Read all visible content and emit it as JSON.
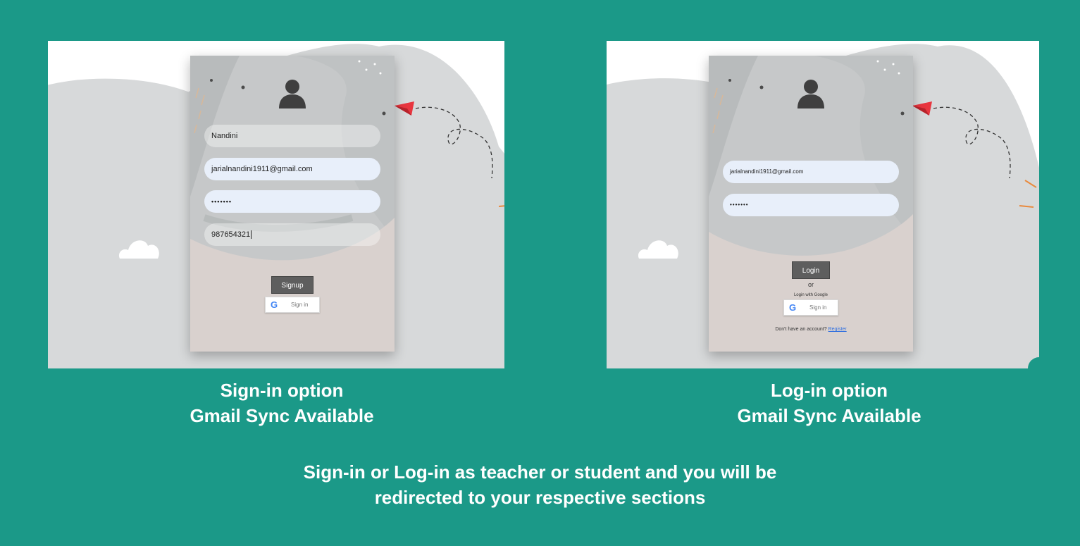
{
  "signup": {
    "name_value": "Nandini",
    "email_value": "jarialnandini1911@gmail.com",
    "password_mask": "•••••••",
    "phone_value": "987654321",
    "signup_label": "Signup",
    "google_label": "Sign in"
  },
  "login": {
    "email_value": "jarialnandini1911@gmail.com",
    "password_mask": "•••••••",
    "login_label": "Login",
    "or_text": "or",
    "google_prompt": "Login with Google",
    "google_label": "Sign in",
    "no_account_text": "Don't have an account?",
    "register_label": "Register"
  },
  "captions": {
    "signup_line1": "Sign-in option",
    "signup_line2": "Gmail Sync Available",
    "login_line1": "Log-in option",
    "login_line2": "Gmail Sync Available",
    "footer_line1": "Sign-in or Log-in as teacher or student and you will be",
    "footer_line2": "redirected to your respective sections"
  },
  "icons": {
    "google_glyph": "G"
  },
  "colors": {
    "page_background": "#1b9988",
    "card_background": "#d9d1ce",
    "input_background": "#e8effa",
    "button_dark": "#5e5e5e",
    "paper_plane": "#e8363f",
    "link": "#2f6fe0"
  }
}
